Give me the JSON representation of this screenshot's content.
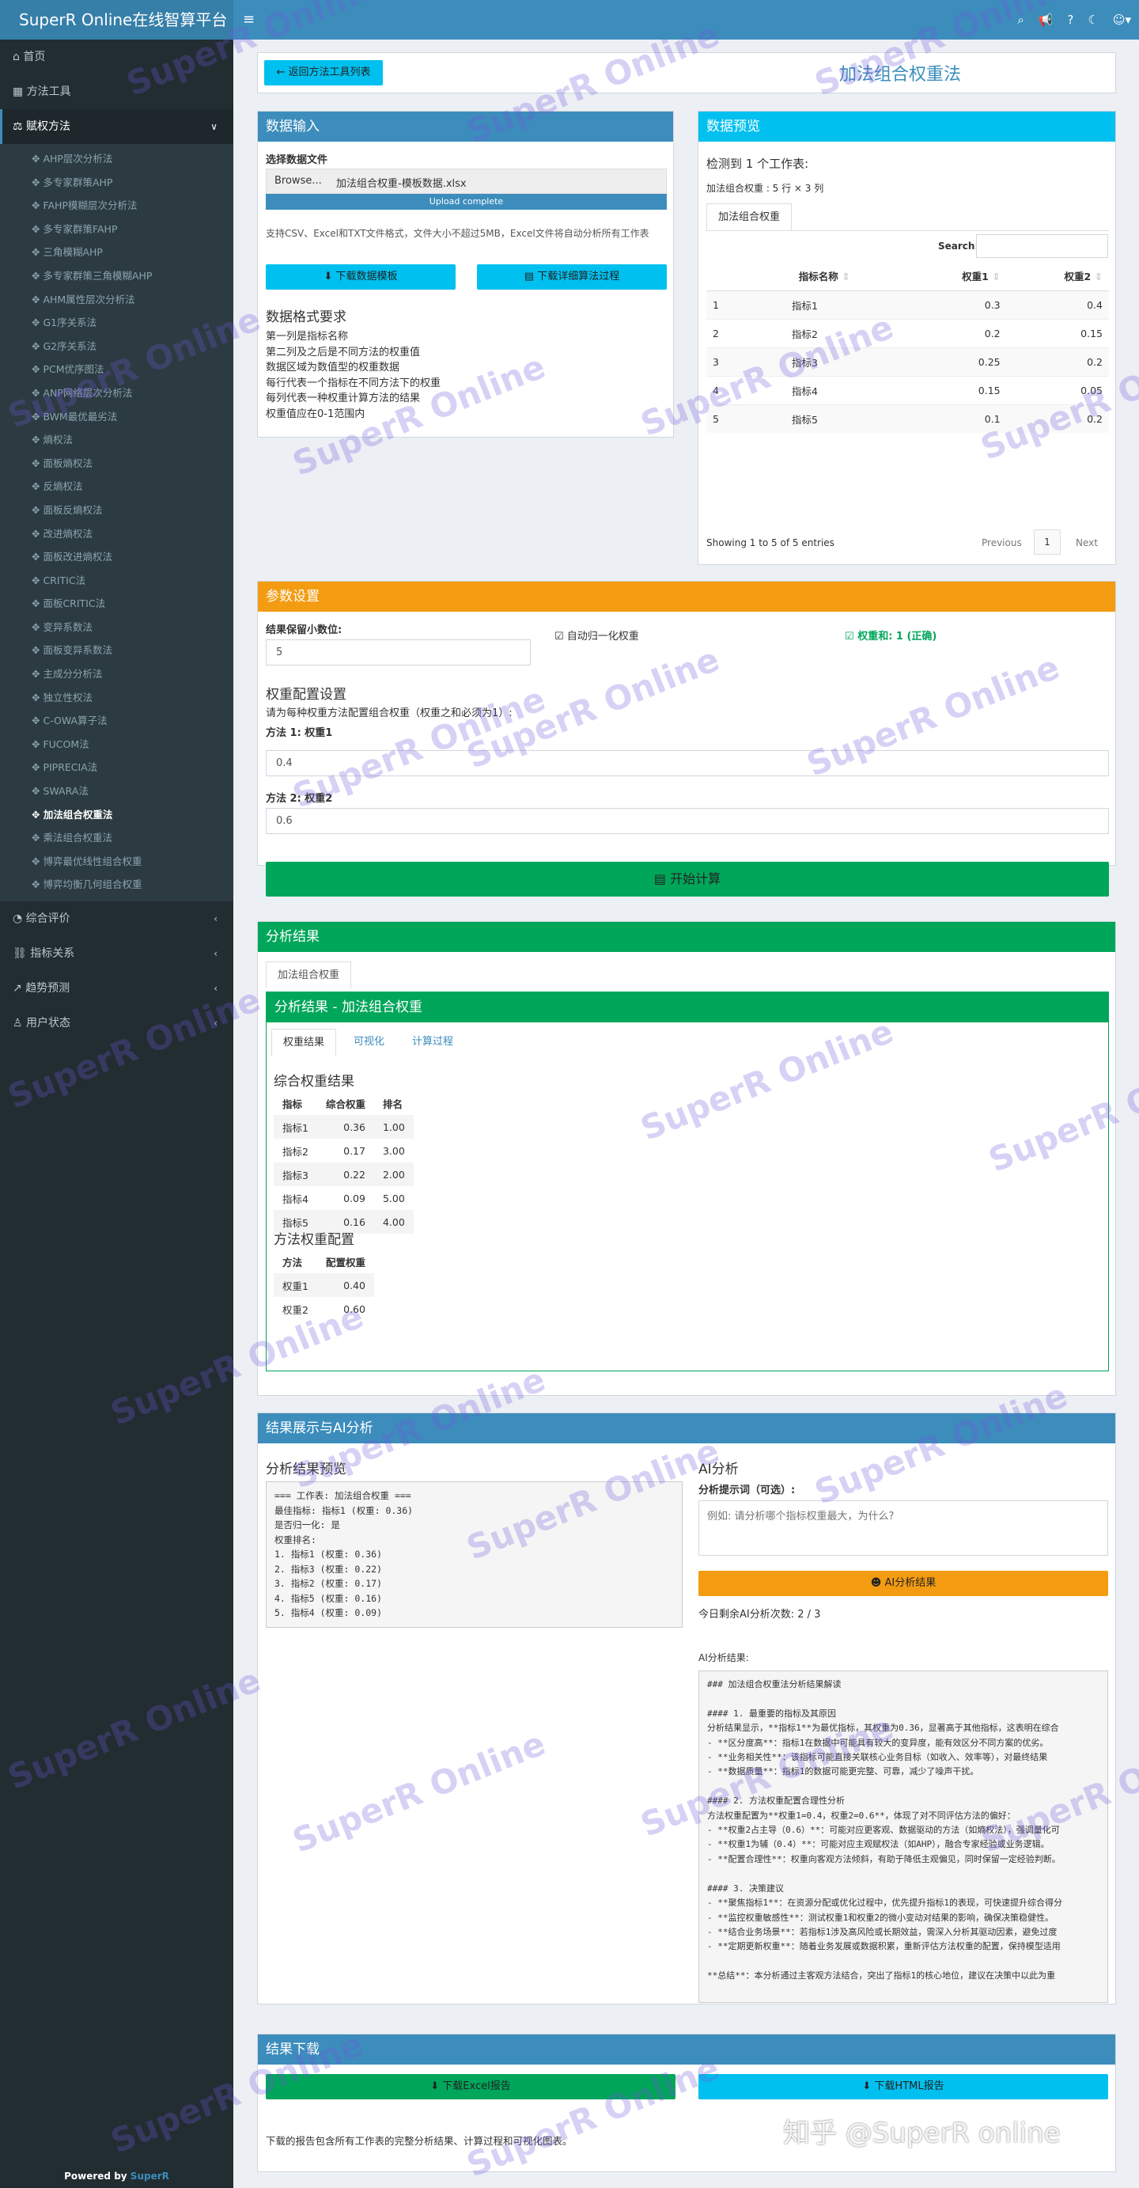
{
  "app": {
    "title": "SuperR Online在线智算平台"
  },
  "topbar": {
    "icons": [
      "search-icon",
      "bullhorn-icon",
      "help-icon",
      "moon-icon",
      "users-icon"
    ]
  },
  "sidebar": {
    "home": "首页",
    "tools": "方法工具",
    "weighting": "赋权方法",
    "items": [
      "AHP层次分析法",
      "多专家群策AHP",
      "FAHP模糊层次分析法",
      "多专家群策FAHP",
      "三角模糊AHP",
      "多专家群策三角模糊AHP",
      "AHM属性层次分析法",
      "G1序关系法",
      "G2序关系法",
      "PCM优序图法",
      "ANP网络层次分析法",
      "BWM最优最劣法",
      "熵权法",
      "面板熵权法",
      "反熵权法",
      "面板反熵权法",
      "改进熵权法",
      "面板改进熵权法",
      "CRITIC法",
      "面板CRITIC法",
      "变异系数法",
      "面板变异系数法",
      "主成分分析法",
      "独立性权法",
      "C-OWA算子法",
      "FUCOM法",
      "PIPRECIA法",
      "SWARA法",
      "加法组合权重法",
      "乘法组合权重法",
      "博弈最优线性组合权重",
      "博弈均衡几何组合权重"
    ],
    "active_index": 28,
    "eval": "综合评价",
    "relation": "指标关系",
    "trend": "趋势预测",
    "user": "用户状态",
    "powered_prefix": "Powered by ",
    "powered_brand": "SuperR"
  },
  "header": {
    "back": "返回方法工具列表",
    "title": "加法组合权重法"
  },
  "input": {
    "title": "数据输入",
    "file_label": "选择数据文件",
    "browse": "Browse...",
    "file_name": "加法组合权重-模板数据.xlsx",
    "progress": "Upload complete",
    "progress_value": 1.0,
    "support": "支持CSV、Excel和TXT文件格式，文件大小不超过5MB，Excel文件将自动分析所有工作表",
    "download_template": "下载数据模板",
    "download_process": "下载详细算法过程",
    "req_title": "数据格式要求",
    "reqs": [
      "第一列是指标名称",
      "第二列及之后是不同方法的权重值",
      "数据区域为数值型的权重数据",
      "每行代表一个指标在不同方法下的权重",
      "每列代表一种权重计算方法的结果",
      "权重值应在0-1范围内"
    ]
  },
  "preview": {
    "title": "数据预览",
    "detected": "检测到 1 个工作表:",
    "sheet_info": "加法组合权重 : 5 行 × 3 列",
    "tab": "加法组合权重",
    "search_label": "Search:",
    "columns": [
      "",
      "指标名称",
      "权重1",
      "权重2"
    ],
    "rows": [
      [
        "1",
        "指标1",
        "0.3",
        "0.4"
      ],
      [
        "2",
        "指标2",
        "0.2",
        "0.15"
      ],
      [
        "3",
        "指标3",
        "0.25",
        "0.2"
      ],
      [
        "4",
        "指标4",
        "0.15",
        "0.05"
      ],
      [
        "5",
        "指标5",
        "0.1",
        "0.2"
      ]
    ],
    "footer": "Showing 1 to 5 of 5 entries",
    "prev": "Previous",
    "page": "1",
    "next": "Next"
  },
  "params": {
    "title": "参数设置",
    "decimals_label": "结果保留小数位:",
    "decimals": "5",
    "auto_norm": "自动归一化权重",
    "weight_sum": "权重和: 1 (正确)",
    "config_title": "权重配置设置",
    "config_note": "请为每种权重方法配置组合权重（权重之和必须为1）:",
    "m1_label": "方法 1: 权重1",
    "m1": "0.4",
    "m2_label": "方法 2: 权重2",
    "m2": "0.6",
    "start": "开始计算"
  },
  "results": {
    "title": "分析结果",
    "outer_tab": "加法组合权重",
    "inner_title": "分析结果 - 加法组合权重",
    "tabs": [
      "权重结果",
      "可视化",
      "计算过程"
    ],
    "comb_title": "综合权重结果",
    "comb_cols": [
      "指标",
      "综合权重",
      "排名"
    ],
    "comb_rows": [
      [
        "指标1",
        "0.36",
        "1.00"
      ],
      [
        "指标2",
        "0.17",
        "3.00"
      ],
      [
        "指标3",
        "0.22",
        "2.00"
      ],
      [
        "指标4",
        "0.09",
        "5.00"
      ],
      [
        "指标5",
        "0.16",
        "4.00"
      ]
    ],
    "method_title": "方法权重配置",
    "method_cols": [
      "方法",
      "配置权重"
    ],
    "method_rows": [
      [
        "权重1",
        "0.40"
      ],
      [
        "权重2",
        "0.60"
      ]
    ]
  },
  "ai": {
    "title": "结果展示与AI分析",
    "preview_title": "分析结果预览",
    "preview_lines": [
      "=== 工作表: 加法组合权重 ===",
      "最佳指标: 指标1 (权重: 0.36)",
      "是否归一化: 是",
      "权重排名:",
      "1. 指标1 (权重: 0.36)",
      "2. 指标3 (权重: 0.22)",
      "3. 指标2 (权重: 0.17)",
      "4. 指标5 (权重: 0.16)",
      "5. 指标4 (权重: 0.09)"
    ],
    "ai_title": "AI分析",
    "prompt_label": "分析提示词（可选）:",
    "prompt_placeholder": "例如: 请分析哪个指标权重最大，为什么?",
    "ai_button": "AI分析结果",
    "remaining": "今日剩余AI分析次数: 2 / 3",
    "result_label": "AI分析结果:",
    "result_lines": [
      "### 加法组合权重法分析结果解读",
      "",
      "#### 1. 最重要的指标及其原因",
      "分析结果显示，**指标1**为最优指标，其权重为0.36，显著高于其他指标，这表明在综合",
      "- **区分度高**：指标1在数据中可能具有较大的变异度，能有效区分不同方案的优劣。",
      "- **业务相关性**：该指标可能直接关联核心业务目标（如收入、效率等），对最终结果",
      "- **数据质量**：指标1的数据可能更完整、可靠，减少了噪声干扰。",
      "",
      "#### 2. 方法权重配置合理性分析",
      "方法权重配置为**权重1=0.4，权重2=0.6**，体现了对不同评估方法的偏好：",
      "- **权重2占主导（0.6）**：可能对应更客观、数据驱动的方法（如熵权法），强调量化可",
      "- **权重1为辅（0.4）**：可能对应主观赋权法（如AHP），融合专家经验或业务逻辑。",
      "- **配置合理性**：权重向客观方法倾斜，有助于降低主观偏见，同时保留一定经验判断。",
      "",
      "#### 3. 决策建议",
      "- **聚焦指标1**：在资源分配或优化过程中，优先提升指标1的表现，可快速提升综合得分",
      "- **监控权重敏感性**：测试权重1和权重2的微小变动对结果的影响，确保决策稳健性。",
      "- **结合业务场景**：若指标1涉及高风险或长期效益，需深入分析其驱动因素，避免过度",
      "- **定期更新权重**：随着业务发展或数据积累，重新评估方法权重的配置，保持模型适用",
      "",
      "**总结**：本分析通过主客观方法结合，突出了指标1的核心地位，建议在决策中以此为重"
    ]
  },
  "download": {
    "title": "结果下载",
    "excel": "下载Excel报告",
    "html": "下载HTML报告",
    "note": "下载的报告包含所有工作表的完整分析结果、计算过程和可视化图表。"
  },
  "watermark_text": "SuperR Online",
  "zhihu_mark": "知乎 @SuperR online",
  "colors": {
    "primary": "#3c8dbc",
    "info": "#00c0ef",
    "warning": "#f39c12",
    "success": "#00a65a",
    "sidebar": "#222d32"
  }
}
